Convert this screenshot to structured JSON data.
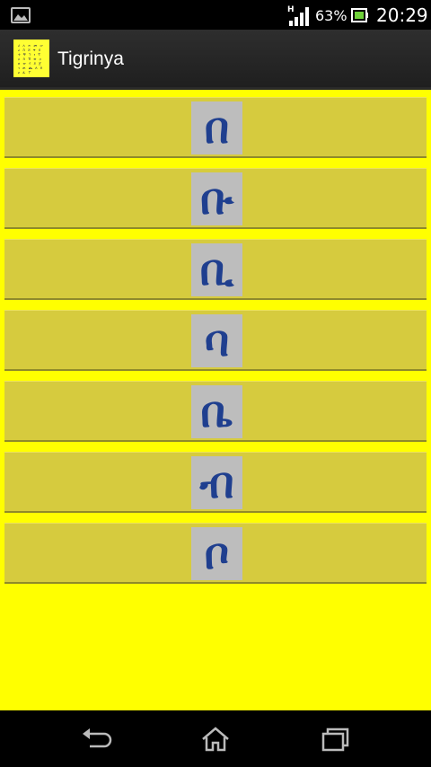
{
  "status_bar": {
    "network_type": "H",
    "battery_percent": "63%",
    "time": "20:29"
  },
  "action_bar": {
    "title": "Tigrinya",
    "app_icon_text": "ሀ ለ ሐ መ ሠ ረ ሰ ሸ ቀ በ ተ ቸ ኀ ነ ኘ አ ከ ኸ ወ ዐ ዘ ዠ የ ደ ጀ ገ ጠ ጨ ጰ ጸ ፀ ፈ ፐ"
  },
  "rows": [
    {
      "glyph": "በ"
    },
    {
      "glyph": "ቡ"
    },
    {
      "glyph": "ቢ"
    },
    {
      "glyph": "ባ"
    },
    {
      "glyph": "ቤ"
    },
    {
      "glyph": "ብ"
    },
    {
      "glyph": "ቦ"
    }
  ],
  "colors": {
    "background": "#ffff00",
    "row": "#d6cb3e",
    "tile": "#bdbdbd",
    "glyph": "#1f3f8f"
  },
  "nav_bar": {
    "back_icon": "back-arrow-icon",
    "home_icon": "home-icon",
    "recents_icon": "recent-apps-icon"
  }
}
